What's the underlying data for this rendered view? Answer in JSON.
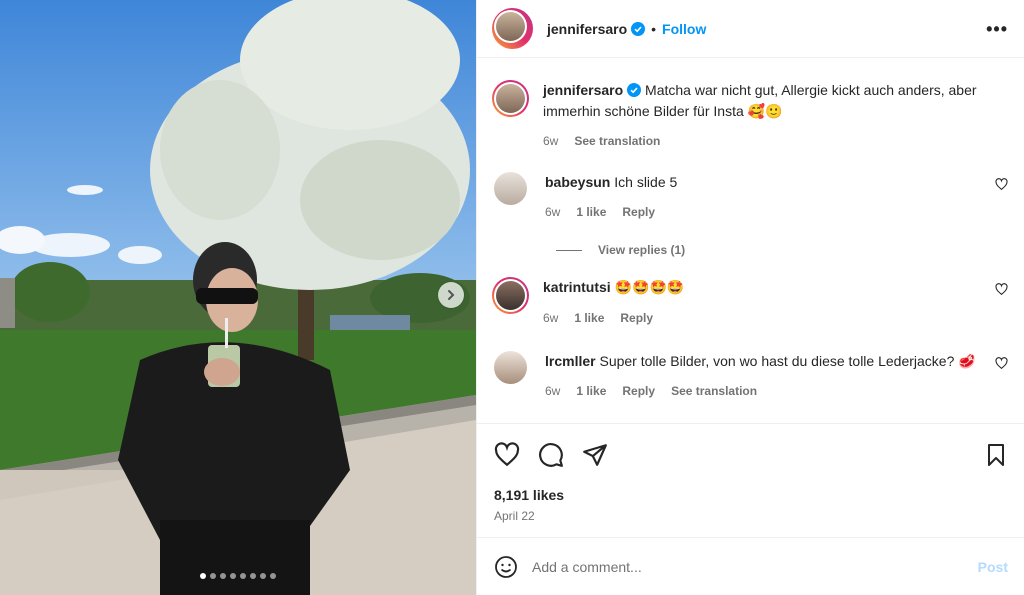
{
  "header": {
    "username": "jennifersaro",
    "separator": "•",
    "follow_label": "Follow",
    "more_label": "•••"
  },
  "caption": {
    "username": "jennifersaro",
    "text": "Matcha war nicht gut, Allergie kickt auch anders, aber immerhin schöne Bilder für Insta 🥰🙂",
    "time": "6w",
    "translation_label": "See translation"
  },
  "comments": [
    {
      "username": "babeysun",
      "text": "Ich slide 5",
      "time": "6w",
      "likes": "1 like",
      "reply_label": "Reply"
    },
    {
      "username": "katrintutsi",
      "text": "🤩🤩🤩🤩",
      "time": "6w",
      "likes": "1 like",
      "reply_label": "Reply"
    },
    {
      "username": "lrcmller",
      "text": "Super tolle Bilder, von wo hast du diese tolle Lederjacke? 🥩",
      "time": "6w",
      "likes": "1 like",
      "reply_label": "Reply",
      "translation_label": "See translation"
    }
  ],
  "view_replies_label": "View replies (1)",
  "likes_text": "8,191 likes",
  "date_text": "April 22",
  "add_comment": {
    "placeholder": "Add a comment...",
    "post_label": "Post"
  },
  "carousel": {
    "total": 8,
    "active": 0
  },
  "colors": {
    "accent": "#0095f6",
    "post_disabled": "#b3dbff",
    "verified": "#0095f6"
  },
  "icons": [
    "heart-icon",
    "comment-icon",
    "share-icon",
    "bookmark-icon",
    "emoji-icon",
    "chevron-right-icon",
    "verified-icon"
  ]
}
